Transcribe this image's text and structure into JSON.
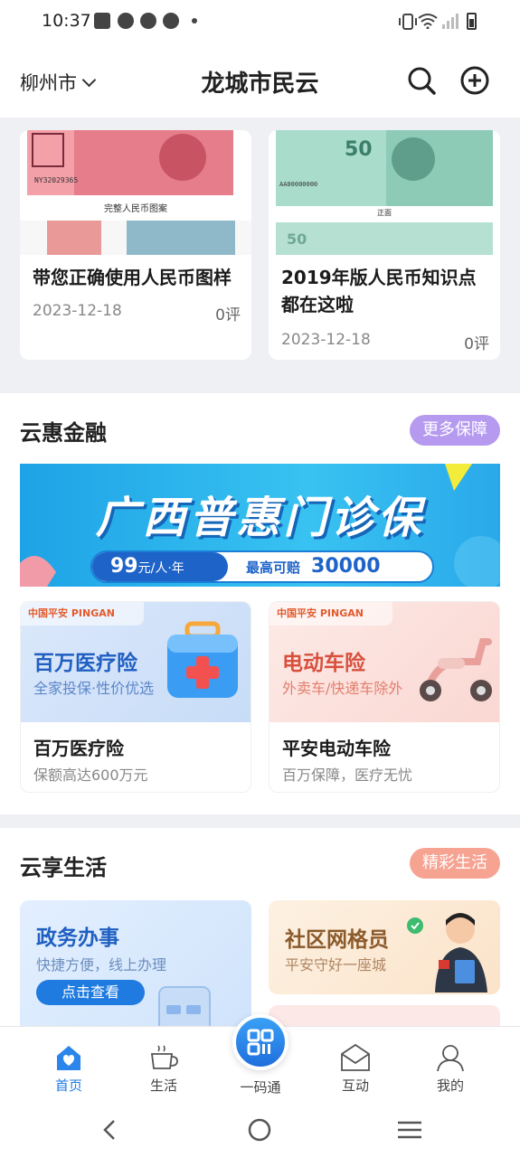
{
  "status_bar": {
    "time": "10:37"
  },
  "header": {
    "city": "柳州市",
    "title": "龙城市民云"
  },
  "news": [
    {
      "title": "带您正确使用人民币图样",
      "date": "2023-12-18",
      "comments": "0评",
      "image_caption": "完整人民币图案"
    },
    {
      "title": "2019年版人民币知识点都在这啦",
      "date": "2023-12-18",
      "comments": "0评",
      "image_caption": "正面"
    }
  ],
  "finance": {
    "title": "云惠金融",
    "more_label": "更多保障",
    "banner": {
      "title": "广西普惠门诊保",
      "price": "99",
      "price_unit": "元/人·年",
      "max_label": "最高可赔",
      "max_value": "30000"
    },
    "cards": [
      {
        "brand": "中国平安 PINGAN",
        "headline": "百万医疗险",
        "tagline": "全家投保·性价优选",
        "name": "百万医疗险",
        "desc": "保额高达600万元"
      },
      {
        "brand": "中国平安 PINGAN",
        "headline": "电动车险",
        "tagline": "外卖车/快递车除外",
        "name": "平安电动车险",
        "desc": "百万保障，医疗无忧"
      }
    ]
  },
  "life": {
    "title": "云享生活",
    "more_label": "精彩生活",
    "cards": [
      {
        "headline": "政务办事",
        "tagline": "快捷方便，线上办理",
        "button": "点击查看"
      },
      {
        "headline": "社区网格员",
        "tagline": "平安守好一座城"
      }
    ]
  },
  "bottom_nav": [
    {
      "label": "首页",
      "icon": "home-icon"
    },
    {
      "label": "生活",
      "icon": "cup-icon"
    },
    {
      "label": "一码通",
      "icon": "qr-code-icon"
    },
    {
      "label": "互动",
      "icon": "mail-icon"
    },
    {
      "label": "我的",
      "icon": "user-icon"
    }
  ],
  "colors": {
    "accent": "#1f7be0",
    "finance_pill": "#b59af0",
    "life_pill": "#f6a392"
  }
}
